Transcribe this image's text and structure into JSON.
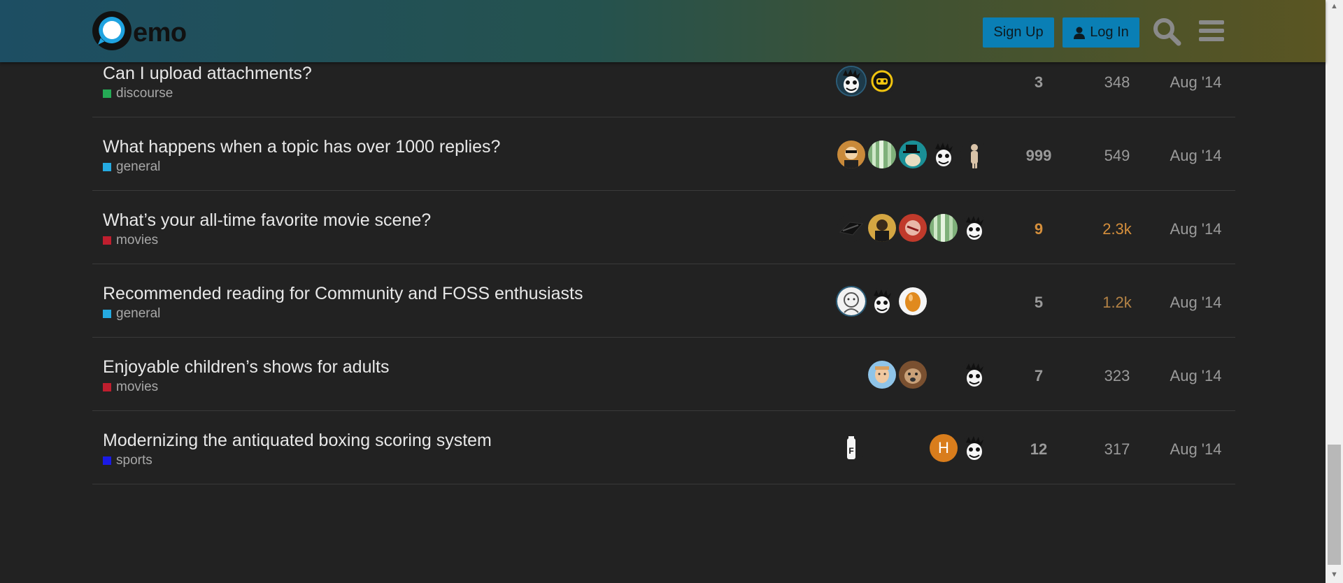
{
  "header": {
    "logo_text": "emo",
    "signup_label": "Sign Up",
    "login_label": "Log In",
    "search_icon": "search-icon",
    "menu_icon": "hamburger-menu-icon"
  },
  "colors": {
    "accent": "#0a7fb5",
    "cat_discourse": "#25aa55",
    "cat_general": "#25aae1",
    "cat_movies": "#bf1e2e",
    "cat_sports": "#1a1ae6",
    "hot": "#d58f3c",
    "warm": "#b48346"
  },
  "topics": [
    {
      "title": "Can I upload attachments?",
      "category": "discourse",
      "replies": "3",
      "views": "348",
      "activity": "Aug '14"
    },
    {
      "title": "What happens when a topic has over 1000 replies?",
      "category": "general",
      "replies": "999",
      "views": "549",
      "activity": "Aug '14"
    },
    {
      "title": "What’s your all-time favorite movie scene?",
      "category": "movies",
      "replies": "9",
      "views": "2.3k",
      "activity": "Aug '14"
    },
    {
      "title": "Recommended reading for Community and FOSS enthusiasts",
      "category": "general",
      "replies": "5",
      "views": "1.2k",
      "activity": "Aug '14"
    },
    {
      "title": "Enjoyable children’s shows for adults",
      "category": "movies",
      "replies": "7",
      "views": "323",
      "activity": "Aug '14"
    },
    {
      "title": "Modernizing the antiquated boxing scoring system",
      "category": "sports",
      "replies": "12",
      "views": "317",
      "activity": "Aug '14"
    }
  ],
  "avatar_letter": "H"
}
